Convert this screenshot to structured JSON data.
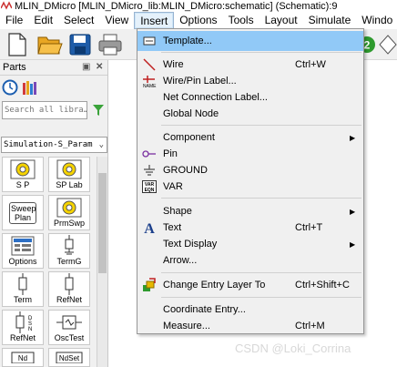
{
  "window": {
    "title": "MLIN_DMicro [MLIN_DMicro_lib:MLIN_DMicro:schematic] (Schematic):9"
  },
  "menubar": {
    "items": [
      {
        "label": "File"
      },
      {
        "label": "Edit"
      },
      {
        "label": "Select"
      },
      {
        "label": "View"
      },
      {
        "label": "Insert"
      },
      {
        "label": "Options"
      },
      {
        "label": "Tools"
      },
      {
        "label": "Layout"
      },
      {
        "label": "Simulate"
      },
      {
        "label": "Windo"
      }
    ]
  },
  "parts_panel": {
    "title": "Parts",
    "search_placeholder": "Search all libra…",
    "library": "Simulation-S_Param",
    "items": [
      {
        "label": "S P",
        "icon": "sp-simulation-icon"
      },
      {
        "label": "SP Lab",
        "icon": "sp-lab-icon"
      },
      {
        "label": "Sweep Plan",
        "icon": "sweep-plan-icon"
      },
      {
        "label": "PrmSwp",
        "icon": "param-sweep-icon"
      },
      {
        "label": "Options",
        "icon": "options-icon"
      },
      {
        "label": "TermG",
        "icon": "term-ground-icon"
      },
      {
        "label": "Term",
        "icon": "term-icon"
      },
      {
        "label": "RefNet",
        "icon": "refnet-icon"
      },
      {
        "label": "RefNet",
        "icon": "refnet-dsn-icon"
      },
      {
        "label": "OscTest",
        "icon": "osctest-icon"
      },
      {
        "label": "",
        "icon": "nd-icon"
      },
      {
        "label": "NdSet",
        "icon": "ndset-icon"
      }
    ],
    "colors": {
      "part_icon_yellow": "#f5d300",
      "accent_green": "#3aa33a"
    }
  },
  "insert_menu": {
    "items": [
      {
        "label": "Template...",
        "shortcut": "",
        "submenu": false,
        "icon": "template-icon",
        "highlighted": true
      },
      {
        "label": "Wire",
        "shortcut": "Ctrl+W",
        "submenu": false,
        "icon": "wire-icon"
      },
      {
        "label": "Wire/Pin Label...",
        "shortcut": "",
        "submenu": false,
        "icon": "wire-pin-label-icon"
      },
      {
        "label": "Net Connection Label...",
        "shortcut": "",
        "submenu": false,
        "icon": ""
      },
      {
        "label": "Global Node",
        "shortcut": "",
        "submenu": false,
        "icon": ""
      },
      {
        "label": "Component",
        "shortcut": "",
        "submenu": true,
        "icon": ""
      },
      {
        "label": "Pin",
        "shortcut": "",
        "submenu": false,
        "icon": "pin-icon"
      },
      {
        "label": "GROUND",
        "shortcut": "",
        "submenu": false,
        "icon": "ground-icon"
      },
      {
        "label": "VAR",
        "shortcut": "",
        "submenu": false,
        "icon": "var-icon"
      },
      {
        "label": "Shape",
        "shortcut": "",
        "submenu": true,
        "icon": ""
      },
      {
        "label": "Text",
        "shortcut": "Ctrl+T",
        "submenu": false,
        "icon": "text-icon"
      },
      {
        "label": "Text Display",
        "shortcut": "",
        "submenu": true,
        "icon": ""
      },
      {
        "label": "Arrow...",
        "shortcut": "",
        "submenu": false,
        "icon": ""
      },
      {
        "label": "Change Entry Layer To",
        "shortcut": "Ctrl+Shift+C",
        "submenu": false,
        "icon": "change-layer-icon"
      },
      {
        "label": "Coordinate Entry...",
        "shortcut": "",
        "submenu": false,
        "icon": ""
      },
      {
        "label": "Measure...",
        "shortcut": "Ctrl+M",
        "submenu": false,
        "icon": ""
      }
    ],
    "highlight_color": "#91c9f7"
  },
  "watermark": "CSDN @Loki_Corrina"
}
